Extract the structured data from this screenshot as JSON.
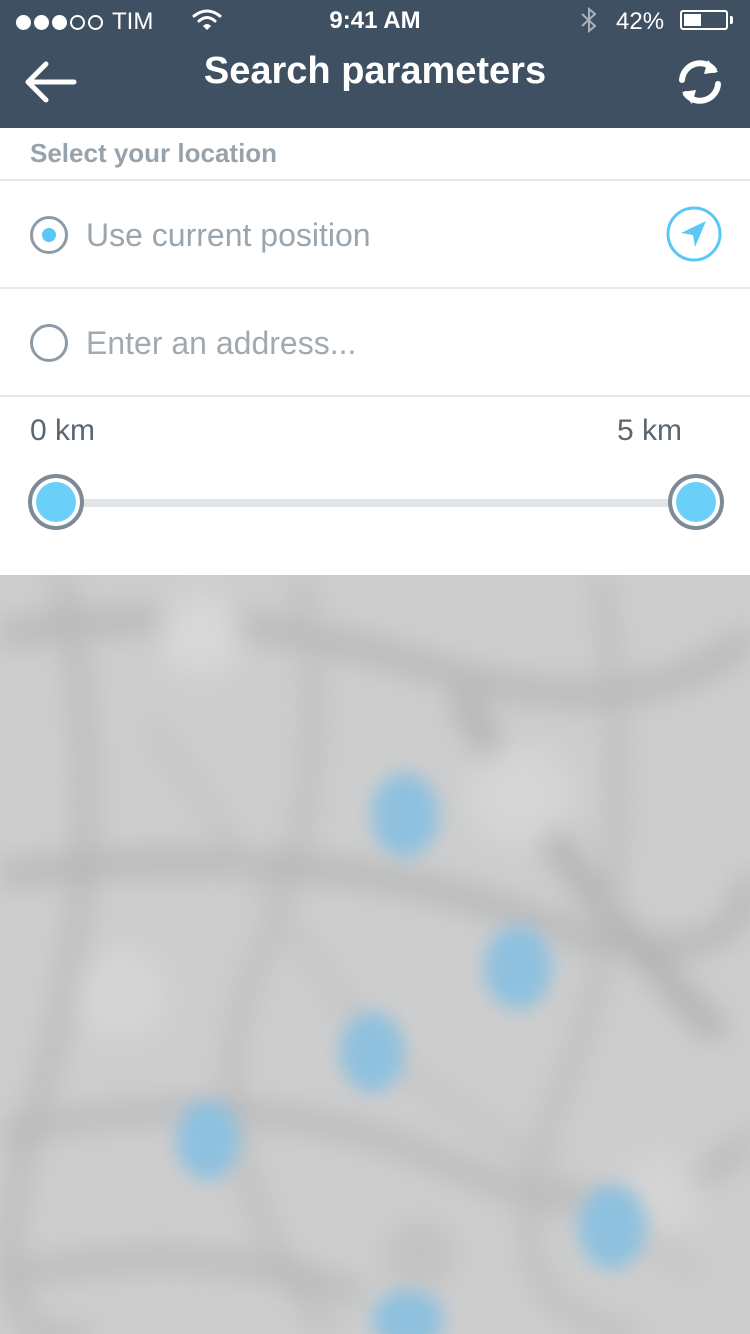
{
  "status_bar": {
    "carrier": "TIM",
    "signal_bars_filled": 3,
    "signal_bars_total": 5,
    "time": "9:41 AM",
    "battery_percent": "42%",
    "battery_level": 0.42
  },
  "header": {
    "title": "Search parameters",
    "back_icon": "back-arrow-icon",
    "refresh_icon": "refresh-icon"
  },
  "location": {
    "section_title": "Select your location",
    "options": [
      {
        "label": "Use current position",
        "selected": true
      },
      {
        "label": "",
        "placeholder": "Enter an address...",
        "selected": false
      }
    ],
    "locate_icon": "location-arrow-icon"
  },
  "distance": {
    "min_label": "0 km",
    "max_label": "5 km",
    "range_min": 0,
    "range_max": 5,
    "low_value": 0,
    "high_value": 5
  },
  "colors": {
    "header_bg": "#3f5063",
    "accent": "#5bc7f7",
    "map_bg": "#cdcdcd",
    "pin": "#8ec1df"
  }
}
